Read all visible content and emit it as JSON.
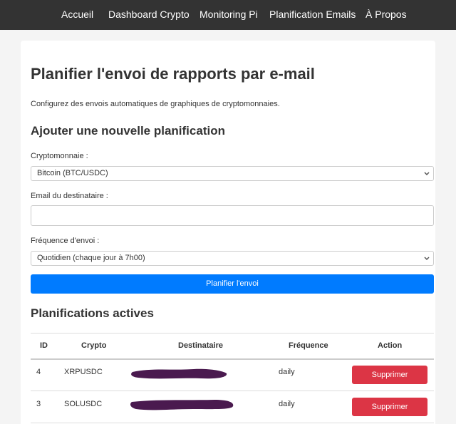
{
  "nav": {
    "items": [
      "Accueil",
      "Dashboard Crypto",
      "Monitoring Pi",
      "Planification Emails",
      "À Propos"
    ]
  },
  "page": {
    "title": "Planifier l'envoi de rapports par e-mail",
    "intro": "Configurez des envois automatiques de graphiques de cryptomonnaies."
  },
  "form": {
    "heading": "Ajouter une nouvelle planification",
    "crypto_label": "Cryptomonnaie :",
    "crypto_value": "Bitcoin (BTC/USDC)",
    "email_label": "Email du destinataire :",
    "email_value": "",
    "frequency_label": "Fréquence d'envoi :",
    "frequency_value": "Quotidien (chaque jour à 7h00)",
    "submit_label": "Planifier l'envoi"
  },
  "schedules": {
    "heading": "Planifications actives",
    "columns": [
      "ID",
      "Crypto",
      "Destinataire",
      "Fréquence",
      "Action"
    ],
    "rows": [
      {
        "id": "4",
        "crypto": "XRPUSDC",
        "recipient": "",
        "frequency": "daily",
        "action": "Supprimer"
      },
      {
        "id": "3",
        "crypto": "SOLUSDC",
        "recipient": "",
        "frequency": "daily",
        "action": "Supprimer"
      }
    ]
  },
  "colors": {
    "navbar": "#333333",
    "primary": "#007bff",
    "danger": "#dc3545",
    "redaction": "#4a1a4f"
  }
}
